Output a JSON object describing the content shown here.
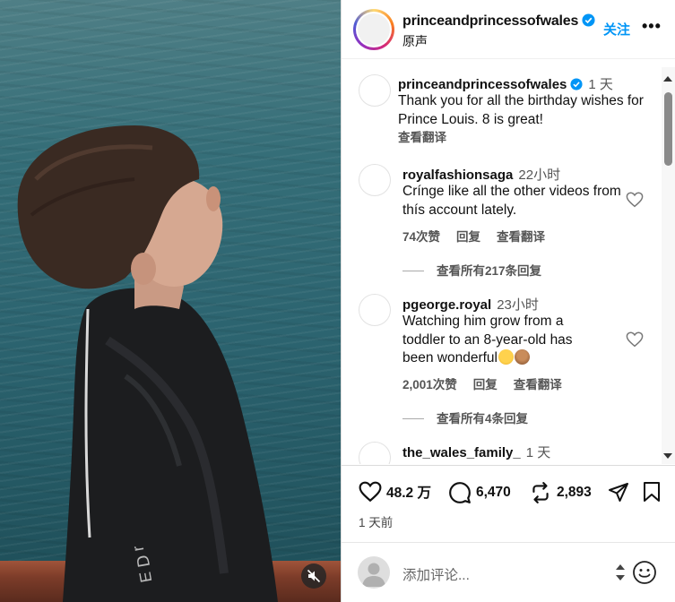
{
  "post": {
    "username": "princeandprincessofwales",
    "subtitle": "原声",
    "follow_label": "关注",
    "more_label": "•••",
    "caption": {
      "username": "princeandprincessofwales",
      "time": "1 天",
      "text": "Thank you for all the birthday wishes for Prince Louis. 8 is great!",
      "translate_label": "查看翻译"
    },
    "comments": [
      {
        "username": "royalfashionsaga",
        "time": "22小时",
        "text": "Crínge like all the other videos from thís account lately.",
        "likes": "74次赞",
        "reply_label": "回复",
        "translate_label": "查看翻译",
        "view_replies": "查看所有217条回复"
      },
      {
        "username": "pgeorge.royal",
        "time": "23小时",
        "text": "Watching him grow from a toddler to an 8-year-old has been wonderful",
        "likes": "2,001次赞",
        "reply_label": "回复",
        "translate_label": "查看翻译",
        "view_replies": "查看所有4条回复"
      },
      {
        "username": "the_wales_family_",
        "time": "1 天"
      }
    ],
    "stats": {
      "likes": "48.2 万",
      "comments": "6,470",
      "reposts": "2,893"
    },
    "posted_ago": "1 天前",
    "composer_placeholder": "添加评论..."
  },
  "colors": {
    "accent": "#0095f6",
    "verified": "#0095f6"
  }
}
